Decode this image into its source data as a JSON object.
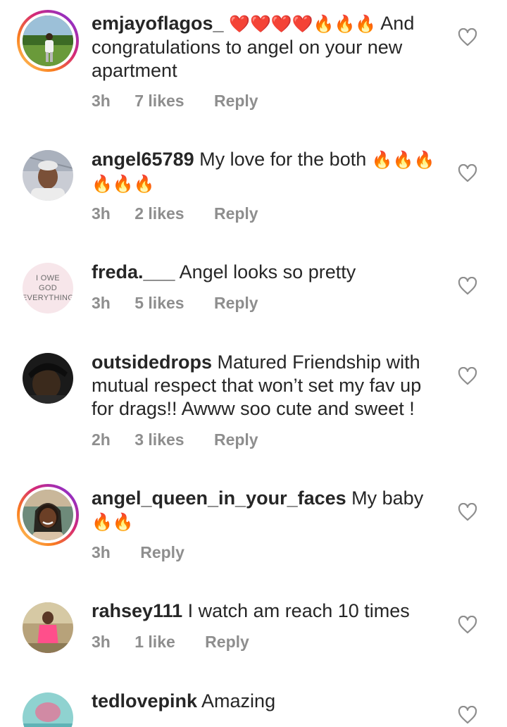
{
  "comments": [
    {
      "username": "emjayoflagos_",
      "pre_emoji": "❤️❤️❤️❤️🔥🔥🔥",
      "text": " And congratulations to angel on your new apartment",
      "time": "3h",
      "likes": "7 likes",
      "reply": "Reply",
      "story_ring": true
    },
    {
      "username": "angel65789",
      "text": " My love for the both",
      "emoji": "🔥🔥🔥🔥🔥🔥",
      "time": "3h",
      "likes": "2 likes",
      "reply": "Reply",
      "story_ring": false
    },
    {
      "username": "freda.___",
      "text": " Angel looks so pretty",
      "time": "3h",
      "likes": "5 likes",
      "reply": "Reply",
      "story_ring": false,
      "avatar_text": [
        "I OWE",
        "GOD",
        "EVERYTHING"
      ]
    },
    {
      "username": "outsidedrops",
      "text": " Matured Friendship with mutual respect that won’t set my fav up for drags!! Awww soo cute and sweet !",
      "time": "2h",
      "likes": "3 likes",
      "reply": "Reply",
      "story_ring": false
    },
    {
      "username": "angel_queen_in_your_faces",
      "text": " My baby",
      "emoji": "🔥🔥",
      "time": "3h",
      "reply": "Reply",
      "story_ring": true
    },
    {
      "username": "rahsey111",
      "text": " I watch am reach 10 times",
      "time": "3h",
      "likes": "1 like",
      "reply": "Reply",
      "story_ring": false
    },
    {
      "username": "tedlovepink",
      "text": " Amazing",
      "story_ring": false
    }
  ],
  "icons": {
    "like": "heart-outline-icon"
  },
  "colors": {
    "text": "#262626",
    "meta": "#8e8e8e",
    "heart": "#8e8e8e"
  }
}
